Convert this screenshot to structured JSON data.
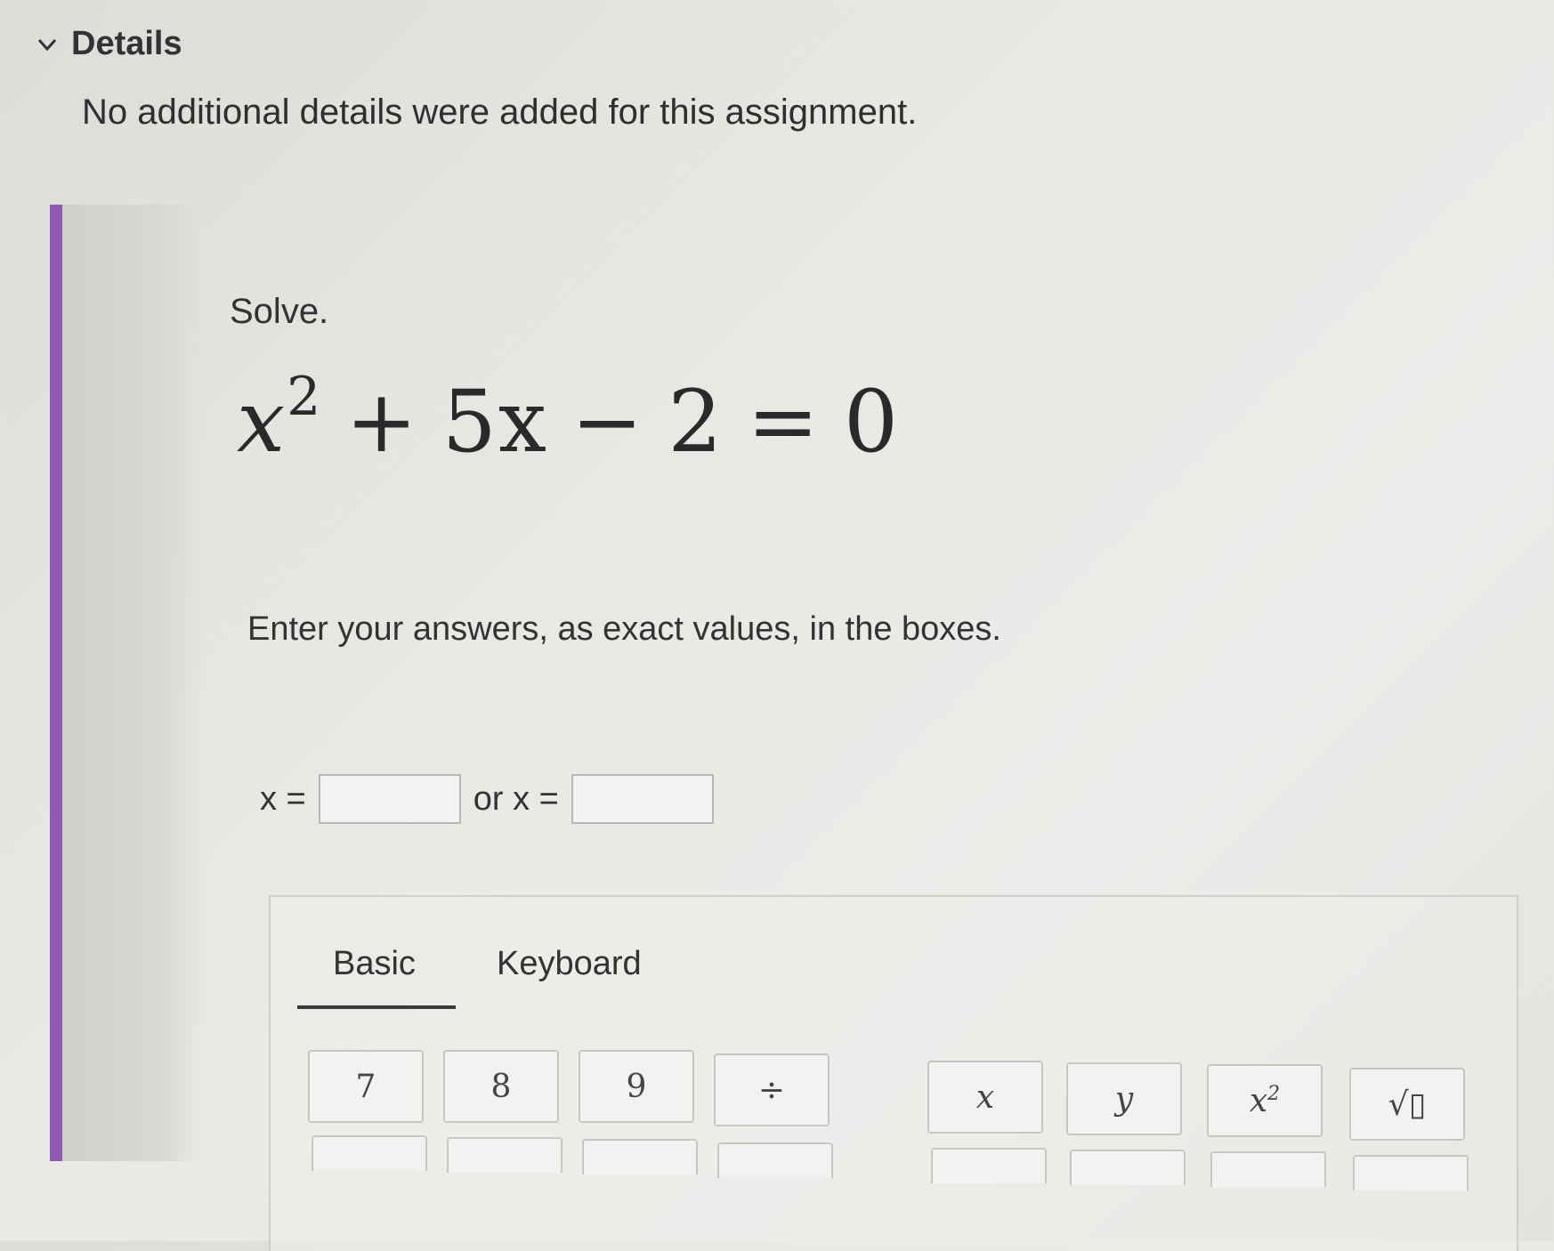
{
  "details": {
    "title": "Details",
    "text": "No additional details were added for this assignment."
  },
  "question": {
    "prompt": "Solve.",
    "equation": {
      "var": "x",
      "exp": "2",
      "plus": "+",
      "coef": "5x",
      "minus": "−",
      "const": "2",
      "eq": "=",
      "rhs": "0"
    },
    "instructions": "Enter your answers, as exact values, in the boxes.",
    "answer": {
      "label1": "x =",
      "value1": "",
      "label2": "or x =",
      "value2": ""
    }
  },
  "keypad": {
    "tabs": [
      "Basic",
      "Keyboard"
    ],
    "active_tab": "Basic",
    "row1": [
      "7",
      "8",
      "9",
      "÷",
      "x",
      "y",
      "x",
      "√▯"
    ],
    "key_x2_exp": "2"
  },
  "colors": {
    "accent": "#8e5bb3"
  }
}
